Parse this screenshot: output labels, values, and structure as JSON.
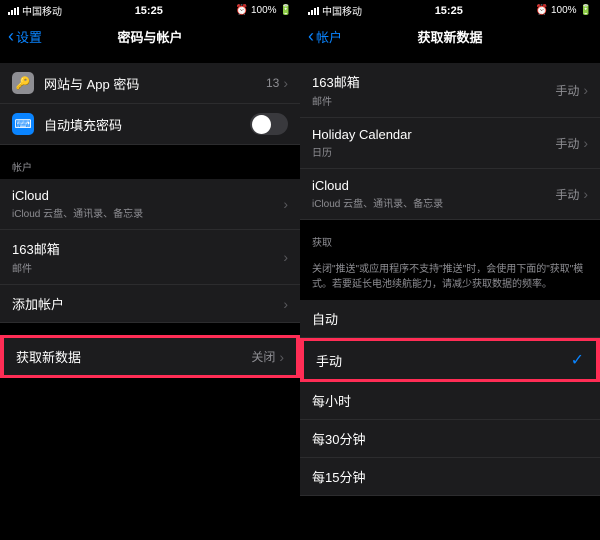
{
  "status": {
    "carrier": "中国移动",
    "time": "15:25",
    "battery": "100%"
  },
  "left": {
    "back": "设置",
    "title": "密码与帐户",
    "rows": {
      "webpass": "网站与 App 密码",
      "webpass_value": "13",
      "autofill": "自动填充密码"
    },
    "accounts_header": "帐户",
    "icloud": {
      "title": "iCloud",
      "sub": "iCloud 云盘、通讯录、备忘录"
    },
    "mail163": {
      "title": "163邮箱",
      "sub": "邮件"
    },
    "add": "添加帐户",
    "fetch": {
      "title": "获取新数据",
      "value": "关闭"
    }
  },
  "right": {
    "back": "帐户",
    "title": "获取新数据",
    "accounts": {
      "mail163": {
        "title": "163邮箱",
        "sub": "邮件",
        "value": "手动"
      },
      "holiday": {
        "title": "Holiday Calendar",
        "sub": "日历",
        "value": "手动"
      },
      "icloud": {
        "title": "iCloud",
        "sub": "iCloud 云盘、通讯录、备忘录",
        "value": "手动"
      }
    },
    "fetch_header": "获取",
    "fetch_note": "关闭\"推送\"或应用程序不支持\"推送\"时，会使用下面的\"获取\"模式。若要延长电池续航能力，请减少获取数据的频率。",
    "options": {
      "auto": "自动",
      "manual": "手动",
      "hourly": "每小时",
      "thirty": "每30分钟",
      "fifteen": "每15分钟"
    }
  }
}
